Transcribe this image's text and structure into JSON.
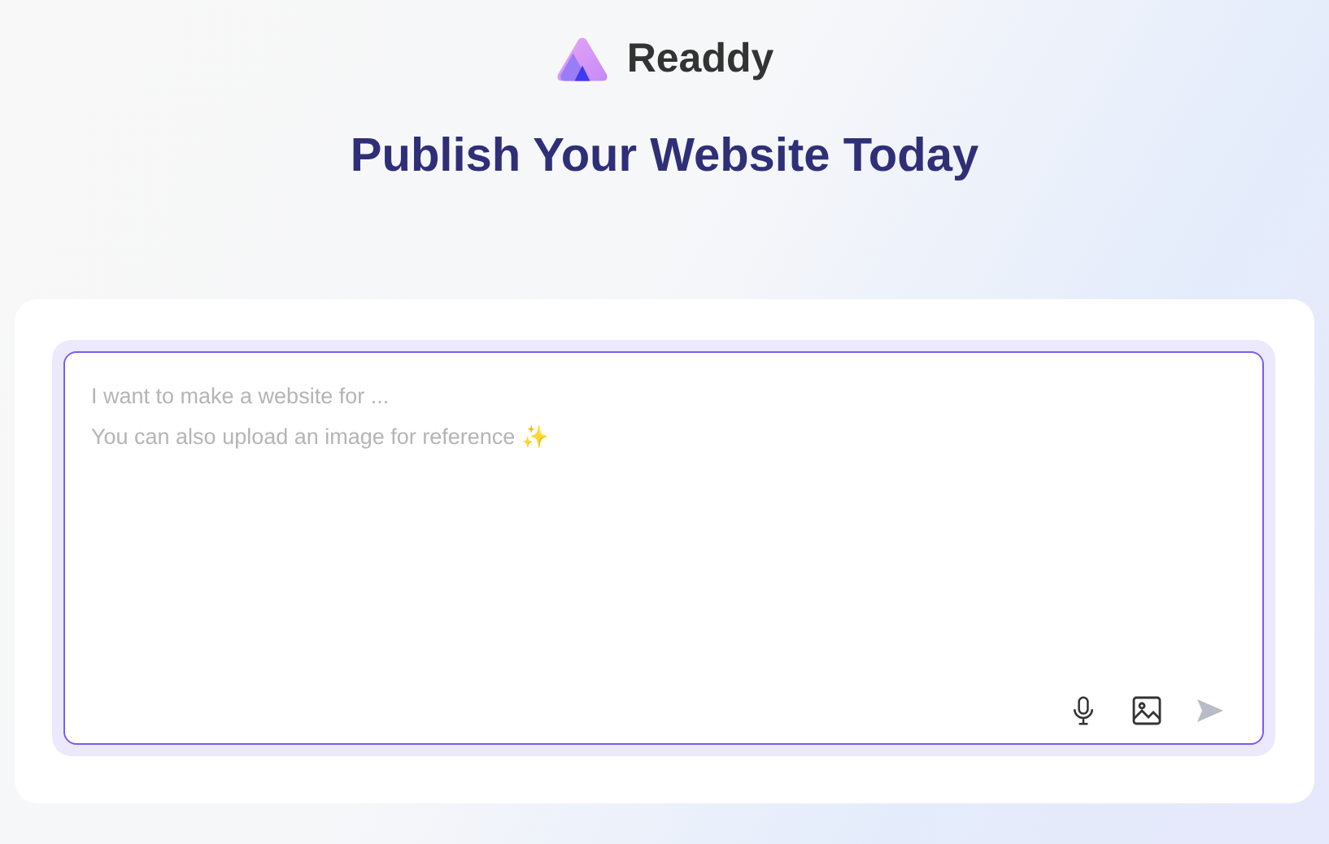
{
  "brand": {
    "name": "Readdy"
  },
  "headline": "Publish Your Website Today",
  "prompt": {
    "placeholder": "I want to make a website for ...\nYou can also upload an image for reference ✨"
  },
  "actions": {
    "send_disabled": true
  }
}
